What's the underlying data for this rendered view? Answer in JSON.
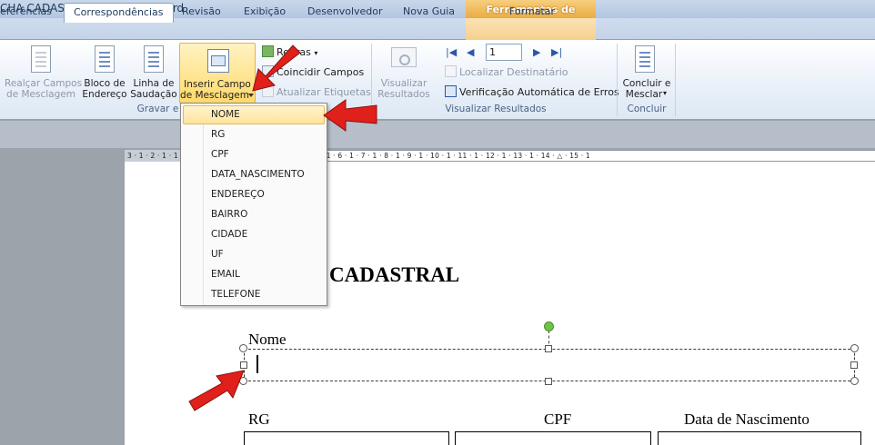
{
  "window": {
    "title": "CHA CADASTRAL  -  Microsoft Word"
  },
  "contextual_header": "Ferramentas de Desenho",
  "tabs": [
    {
      "label": "eferências"
    },
    {
      "label": "Correspondências",
      "active": true
    },
    {
      "label": "Revisão"
    },
    {
      "label": "Exibição"
    },
    {
      "label": "Desenvolvedor"
    },
    {
      "label": "Nova Guia"
    },
    {
      "label": "Formatar"
    }
  ],
  "ribbon": {
    "realcar": {
      "line1": "Realçar Campos",
      "line2": "de Mesclagem"
    },
    "bloco": {
      "line1": "Bloco de",
      "line2": "Endereço"
    },
    "linha": {
      "line1": "Linha de",
      "line2": "Saudação"
    },
    "inserir": {
      "line1": "Inserir Campo",
      "line2": "de Mesclagem"
    },
    "regras": "Regras",
    "coincidir": "Coincidir Campos",
    "atualizar": "Atualizar Etiquetas",
    "group_gravar": "Gravar e In",
    "visualizar": {
      "line1": "Visualizar",
      "line2": "Resultados"
    },
    "record_number": "1",
    "localizar": "Localizar Destinatário",
    "verificacao": "Verificação Automática de Erros",
    "group_visualizar": "Visualizar Resultados",
    "concluir": {
      "line1": "Concluir e",
      "line2": "Mesclar"
    },
    "group_concluir": "Concluir"
  },
  "ruler_text": "3 · 1 · 2 · 1 · 1 · 1 · ■ · 1 · 1 · 1 · 2 · 1 · 3 · 1 · 4 · 1 · 5 · 1 · 6 · 1 · 7 · 1 · 8 · 1 · 9 · 1 · 10 · 1 · 11 · 1 · 12 · 1 · 13 · 1 · 14 · △ · 15 · 1",
  "merge_fields": [
    "NOME",
    "RG",
    "CPF",
    "DATA_NASCIMENTO",
    "ENDEREÇO",
    "BAIRRO",
    "CIDADE",
    "UF",
    "EMAIL",
    "TELEFONE"
  ],
  "document": {
    "title": "CADASTRAL",
    "label_nome": "Nome",
    "label_rg": "RG",
    "label_cpf": "CPF",
    "label_data_nascimento": "Data de Nascimento"
  },
  "colors": {
    "arrow": "#e0201b",
    "highlight": "#ffe39a",
    "contextual": "#e8a83c"
  }
}
